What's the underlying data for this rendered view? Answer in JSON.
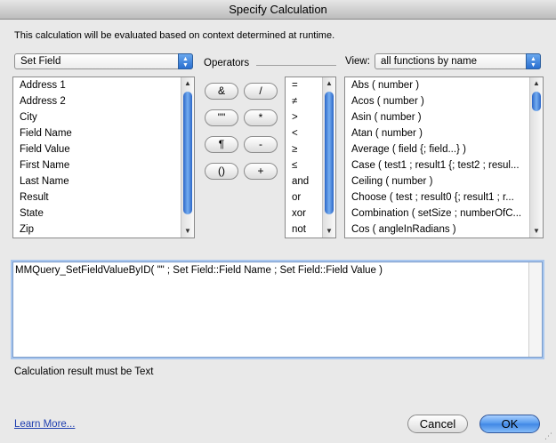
{
  "window": {
    "title": "Specify Calculation"
  },
  "description": "This calculation will be evaluated based on context determined at runtime.",
  "table_popup": {
    "selected": "Set Field"
  },
  "operators": {
    "label": "Operators",
    "buttons": [
      "&",
      "/",
      "\"\"",
      "*",
      "¶",
      "-",
      "()",
      "+"
    ],
    "list": [
      "=",
      "≠",
      ">",
      "<",
      "≥",
      "≤",
      "and",
      "or",
      "xor",
      "not"
    ]
  },
  "view": {
    "label": "View:",
    "selected": "all functions by name"
  },
  "fields": [
    "Address 1",
    "Address 2",
    "City",
    "Field Name",
    "Field Value",
    "First Name",
    "Last Name",
    "Result",
    "State",
    "Zip"
  ],
  "functions": [
    "Abs ( number )",
    "Acos ( number )",
    "Asin ( number )",
    "Atan ( number )",
    "Average ( field {; field...} )",
    "Case ( test1 ; result1 {; test2 ; resul...",
    "Ceiling ( number )",
    "Choose ( test ; result0 {; result1 ; r...",
    "Combination ( setSize ; numberOfC...",
    "Cos ( angleInRadians )"
  ],
  "calculation": {
    "text": "MMQuery_SetFieldValueByID( \"\" ; Set Field::Field Name ; Set Field::Field Value )"
  },
  "result_type": "Calculation result must be Text",
  "learn_more": "Learn More...",
  "buttons": {
    "cancel": "Cancel",
    "ok": "OK"
  }
}
